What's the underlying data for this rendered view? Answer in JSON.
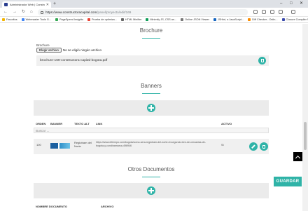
{
  "browser": {
    "tab_title": "Administrador Web | Constructora",
    "new_tab": "+",
    "url_host": "https://www.constructoracapital.com",
    "url_path": "/panel/proyecto/edit/169",
    "bookmarks": [
      {
        "label": "Favoritos",
        "color": "#f4b400"
      },
      {
        "label": "Webmaster Tools G...",
        "color": "#4285f4"
      },
      {
        "label": "PageSpeed Insights",
        "color": "#34a853"
      },
      {
        "label": "Prueba de optimiza...",
        "color": "#ea4335"
      },
      {
        "label": "HTML Minifier",
        "color": "#666666"
      },
      {
        "label": "Minimify JS, CSS an...",
        "color": "#0f9d58"
      },
      {
        "label": "Online JSON Viewer",
        "color": "#777777"
      },
      {
        "label": "JSHint, a JavaScript...",
        "color": "#1565c0"
      },
      {
        "label": "Diff Checker - Onlin...",
        "color": "#fb8c00"
      },
      {
        "label": "Closure Compiler S...",
        "color": "#3949ab"
      }
    ]
  },
  "brochure": {
    "section_title": "Brochure",
    "field_label": "Brochure",
    "file_button": "Elegir archivo",
    "file_none": "No se eligió ningún archivo",
    "current_file": "brochure-169-constructora-capital-bogota.pdf"
  },
  "banners": {
    "section_title": "Banners",
    "columns": [
      "ORDEN",
      "BANNER",
      "TEXTO ALT",
      "LINK",
      "ACTIVO"
    ],
    "search_placeholder": "Buscar ...",
    "rows": [
      {
        "orden": "100",
        "texto_alt": "Regiotram del Norte",
        "link": "https://www.eltiempo.com/bogota/como-sera-regiotram-del-norte-el-segundo-tren-de-cercanias-de-bogota-y-cundinamarca-496946",
        "activo": "Si"
      }
    ]
  },
  "otros_documentos": {
    "section_title": "Otros Documentos",
    "columns": [
      "NOMBRE DOCUMENTO",
      "ARCHIVO"
    ]
  },
  "actions": {
    "save_label": "GUARDAR"
  },
  "colors": {
    "accent": "#2fb3a7"
  }
}
